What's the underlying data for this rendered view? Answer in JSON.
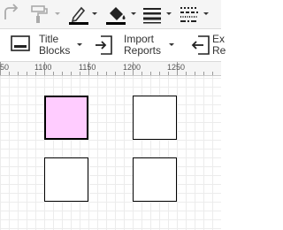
{
  "toolbar": {
    "redo": "redo-icon",
    "format_painter": "paint-roller-icon",
    "line_color": "pen-line-color-icon",
    "fill_color": "paint-bucket-icon",
    "line_weight": "line-weight-icon",
    "line_style": "line-style-icon"
  },
  "ribbon": {
    "title_blocks": {
      "line1": "Title",
      "line2": "Blocks"
    },
    "import_reports": {
      "line1": "Import",
      "line2": "Reports"
    },
    "export_reports": {
      "line1": "Ex",
      "line2": "Re"
    }
  },
  "ruler": {
    "labels": [
      "50",
      "1100",
      "1150",
      "1200",
      "1250"
    ]
  },
  "canvas": {
    "shapes": [
      {
        "id": "shape-1",
        "fill": "#ffccff",
        "selected": true
      },
      {
        "id": "shape-2",
        "fill": "#ffffff",
        "selected": false
      },
      {
        "id": "shape-3",
        "fill": "#ffffff",
        "selected": false
      },
      {
        "id": "shape-4",
        "fill": "#ffffff",
        "selected": false
      }
    ]
  }
}
